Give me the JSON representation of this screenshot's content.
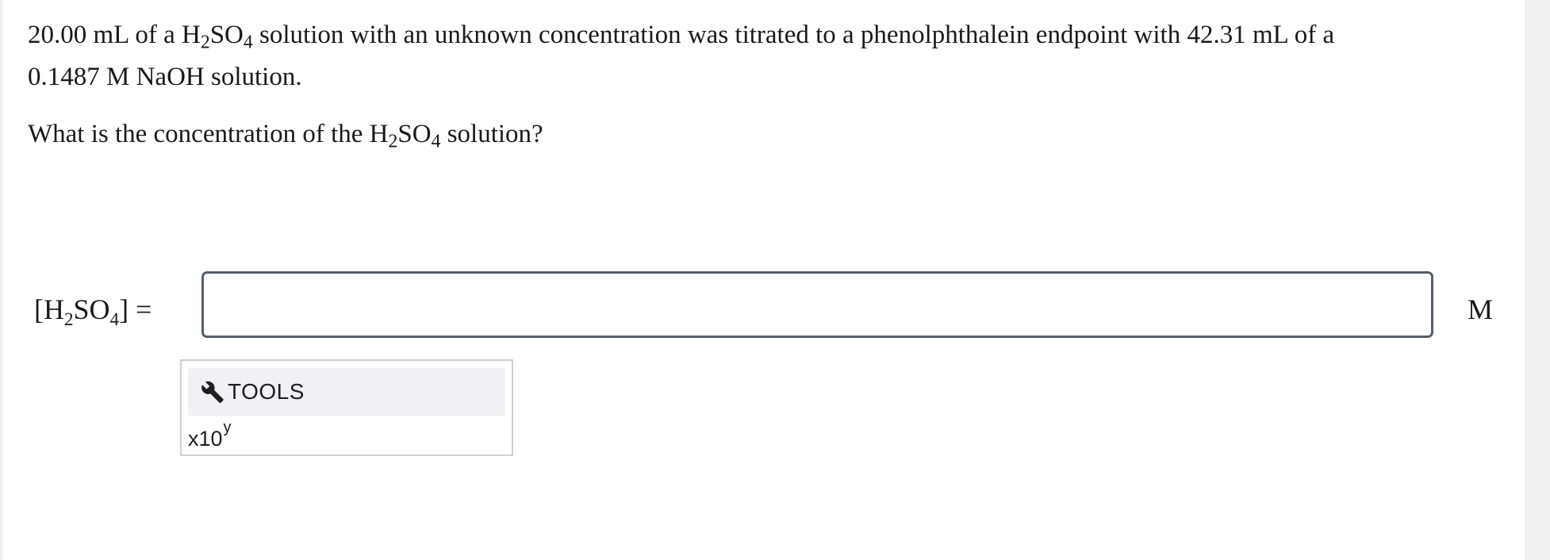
{
  "question": {
    "line1_a": "20.00 mL of a H",
    "line1_sub2": "2",
    "line1_b": "SO",
    "line1_sub4": "4",
    "line1_c": " solution with an unknown concentration was titrated to a phenolphthalein endpoint with 42.31 mL of a",
    "line2": "0.1487 M NaOH solution.",
    "q_a": "What is the concentration of the H",
    "q_sub2": "2",
    "q_b": "SO",
    "q_sub4": "4",
    "q_c": " solution?"
  },
  "answer": {
    "label_open": "[H",
    "label_sub2": "2",
    "label_mid": "SO",
    "label_sub4": "4",
    "label_close": "] =",
    "value": "",
    "placeholder": "",
    "unit": "M"
  },
  "tools": {
    "header_label": "TOOLS",
    "header_icon": "wrench-icon",
    "sci_base": "x10",
    "sci_exp": "y"
  },
  "colors": {
    "input_border": "#545f6b",
    "tools_header_bg": "#f0f1f4",
    "panel_border": "#cfcfcf",
    "rail_bg": "#f1f1f3"
  }
}
